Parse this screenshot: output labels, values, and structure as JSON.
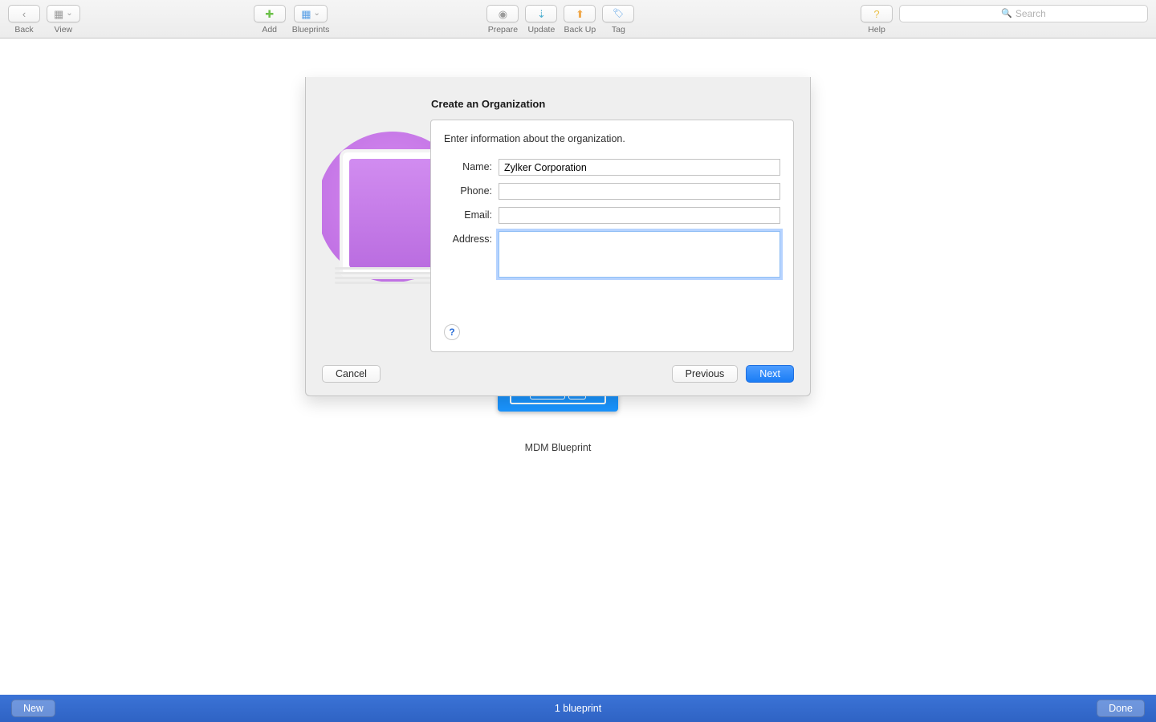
{
  "toolbar": {
    "back": "Back",
    "view": "View",
    "add": "Add",
    "blueprints": "Blueprints",
    "prepare": "Prepare",
    "update": "Update",
    "backup": "Back Up",
    "tag": "Tag",
    "help": "Help",
    "search_placeholder": "Search"
  },
  "sheet": {
    "title": "Create an Organization",
    "description": "Enter information about the organization.",
    "labels": {
      "name": "Name:",
      "phone": "Phone:",
      "email": "Email:",
      "address": "Address:"
    },
    "values": {
      "name": "Zylker Corporation",
      "phone": "",
      "email": "",
      "address": ""
    },
    "help_glyph": "?",
    "buttons": {
      "cancel": "Cancel",
      "previous": "Previous",
      "next": "Next"
    }
  },
  "content": {
    "blueprint_label": "MDM Blueprint"
  },
  "bottom": {
    "new": "New",
    "status": "1 blueprint",
    "done": "Done"
  },
  "icons": {
    "chevron_left": "‹",
    "grid": "▦",
    "plus": "✚",
    "globe": "◉",
    "download": "⇣",
    "up": "⬆",
    "tag": "🏷",
    "help": "?",
    "search": "🔍",
    "dropdown": "⌄"
  }
}
